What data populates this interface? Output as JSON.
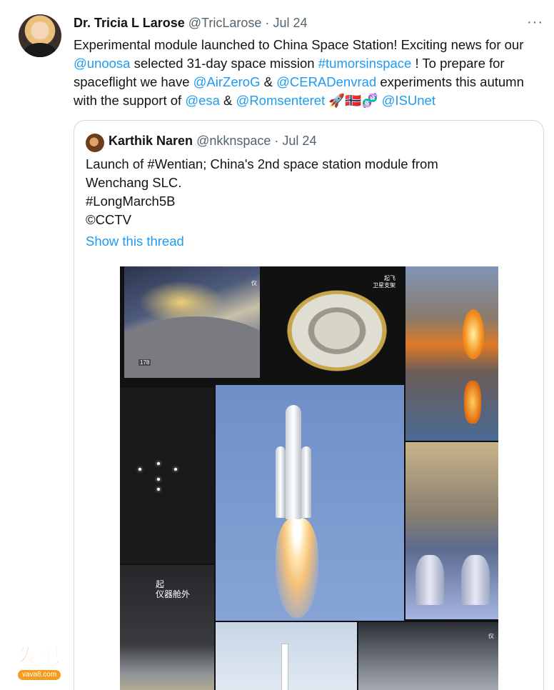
{
  "tweet": {
    "author_name": "Dr. Tricia L Larose",
    "author_handle": "@TricLarose",
    "separator": "·",
    "date": "Jul 24",
    "more_label": "···",
    "text_segments": [
      {
        "t": "Experimental module launched to China Space Station! Exciting news for our ",
        "link": false
      },
      {
        "t": "@unoosa",
        "link": true
      },
      {
        "t": " selected 31-day space mission ",
        "link": false
      },
      {
        "t": "#tumorsinspace",
        "link": true
      },
      {
        "t": " ! To prepare for spaceflight we have  ",
        "link": false
      },
      {
        "t": "@AirZeroG",
        "link": true
      },
      {
        "t": " & ",
        "link": false
      },
      {
        "t": "@CERADenvrad",
        "link": true
      },
      {
        "t": " experiments this autumn with the support of ",
        "link": false
      },
      {
        "t": "@esa",
        "link": true
      },
      {
        "t": " & ",
        "link": false
      },
      {
        "t": "@Romsenteret",
        "link": true
      },
      {
        "t": " 🚀🇳🇴🧬 ",
        "link": false
      },
      {
        "t": "@ISUnet",
        "link": true
      }
    ]
  },
  "quote": {
    "author_name": "Karthik Naren",
    "author_handle": "@nkknspace",
    "separator": "·",
    "date": "Jul 24",
    "text": "Launch of #Wentian; China's 2nd space station module from\nWenchang SLC.\n#LongMarch5B\n©CCTV",
    "show_thread_label": "Show this thread",
    "media_labels": {
      "p1_tag": "178",
      "p1_cn": "仪",
      "p2_cn": "起飞\n卫星支架",
      "p7_cn": "起\n仪器舱外",
      "p9_cn": "仪"
    }
  },
  "watermark": {
    "title": "发吧",
    "subtitle": "vava8.com"
  }
}
